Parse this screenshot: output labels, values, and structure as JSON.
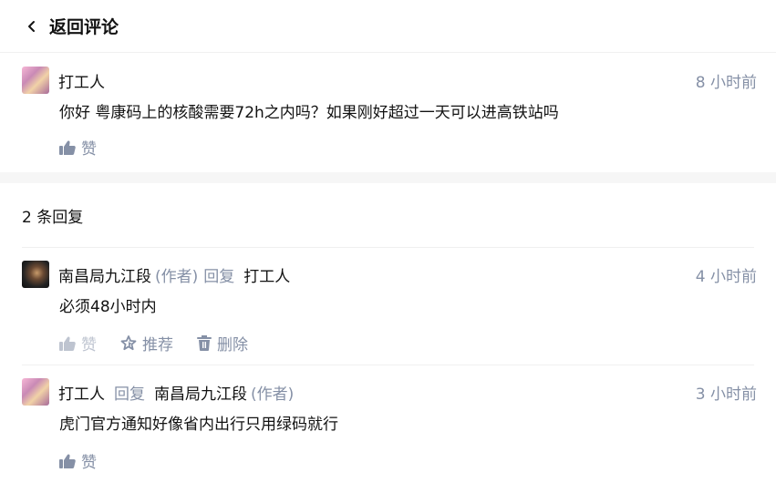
{
  "header": {
    "back_label": "返回评论"
  },
  "main_comment": {
    "author": "打工人",
    "time": "8 小时前",
    "content": "你好 粤康码上的核酸需要72h之内吗？如果刚好超过一天可以进高铁站吗",
    "like_label": "赞"
  },
  "replies_header": "2 条回复",
  "replies": [
    {
      "author": "南昌局九江段",
      "author_tag": "(作者)",
      "reply_word": "回复",
      "reply_to": "打工人",
      "reply_to_tag": "",
      "time": "4 小时前",
      "content": "必须48小时内",
      "like_label": "赞",
      "recommend_label": "推荐",
      "delete_label": "删除"
    },
    {
      "author": "打工人",
      "author_tag": "",
      "reply_word": "回复",
      "reply_to": "南昌局九江段",
      "reply_to_tag": "(作者)",
      "time": "3 小时前",
      "content": "虎门官方通知好像省内出行只用绿码就行",
      "like_label": "赞"
    }
  ],
  "colors": {
    "meta_gray": "#8590a6",
    "faded_gray": "#bec4d0",
    "text": "#121212"
  }
}
